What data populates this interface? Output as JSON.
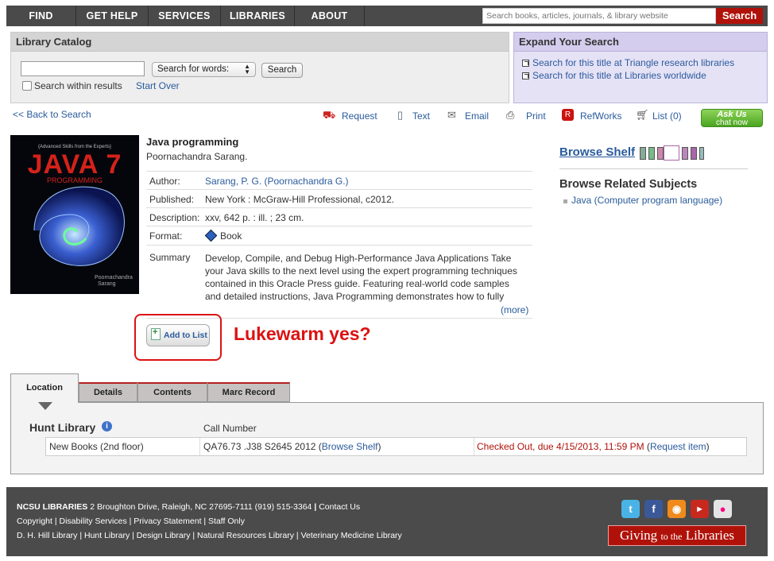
{
  "nav": {
    "items": [
      "FIND",
      "GET HELP",
      "SERVICES",
      "LIBRARIES",
      "ABOUT"
    ],
    "search_placeholder": "Search books, articles, journals, & library website",
    "search_button": "Search"
  },
  "catalog": {
    "heading": "Library Catalog",
    "select_value": "Search for words:",
    "search_button": "Search",
    "within_label": "Search within results",
    "start_over": "Start Over"
  },
  "expand": {
    "heading": "Expand Your Search",
    "links": [
      "Search for this title at Triangle research libraries",
      "Search for this title at Libraries worldwide"
    ]
  },
  "actions": {
    "back": "<< Back to Search",
    "request": "Request",
    "text": "Text",
    "email": "Email",
    "print": "Print",
    "refworks": "RefWorks",
    "list": "List (0)",
    "ask_us_1": "Ask Us",
    "ask_us_2": "chat now"
  },
  "record": {
    "cover_series": "{Advanced Skills from the Experts}",
    "cover_title": "JAVA 7",
    "cover_sub": "PROGRAMMING",
    "cover_author_1": "Poornachandra",
    "cover_author_2": "Sarang",
    "title": "Java programming",
    "responsibility": "Poornachandra Sarang.",
    "author_label": "Author:",
    "author": "Sarang, P. G. (Poornachandra G.)",
    "published_label": "Published:",
    "published": "New York : McGraw-Hill Professional, c2012.",
    "description_label": "Description:",
    "description": "xxv, 642 p. : ill. ; 23 cm.",
    "format_label": "Format:",
    "format": "Book",
    "summary_label": "Summary",
    "summary": "Develop, Compile, and Debug High-Performance Java Applications Take your Java skills to the next level using the expert programming techniques contained in this Oracle Press guide. Featuring real-world code samples and detailed instructions, Java Programming demonstrates how to fully",
    "more": "(more)",
    "add_to_list": "Add to List",
    "annotation": "Lukewarm yes?"
  },
  "sidebar": {
    "browse_shelf": "Browse Shelf",
    "related_heading": "Browse Related Subjects",
    "subject": "Java (Computer program language)",
    "book_colors": [
      "#8a9",
      "#7b8",
      "#c8a",
      "#b8b",
      "#a6a",
      "#9bb"
    ]
  },
  "tabs": [
    "Location",
    "Details",
    "Contents",
    "Marc Record"
  ],
  "location": {
    "library": "Hunt Library",
    "call_number_heading": "Call Number",
    "collection": "New Books (2nd floor)",
    "call_number": "QA76.73 .J38 S2645 2012",
    "browse_shelf_link": "Browse Shelf",
    "status": "Checked Out, due 4/15/2013, 11:59 PM",
    "request_item": "Request item"
  },
  "footer": {
    "org": "NCSU LIBRARIES",
    "address": "2 Broughton Drive, Raleigh, NC 27695-7111 (919) 515-3364",
    "contact": "Contact Us",
    "line2": [
      "Copyright",
      "Disability Services",
      "Privacy Statement",
      "Staff Only"
    ],
    "line3": [
      "D. H. Hill Library",
      "Hunt Library",
      "Design Library",
      "Natural Resources Library",
      "Veterinary Medicine Library"
    ],
    "giving_1": "Giving",
    "giving_2": "to the",
    "giving_3": "Libraries",
    "social": [
      "twitter-icon",
      "facebook-icon",
      "rss-icon",
      "youtube-icon",
      "flickr-icon"
    ]
  },
  "colors": {
    "nav": "#4a4a4a",
    "brand_red": "#b0120a",
    "link": "#2a5b9c",
    "status_red": "#b0120a",
    "annotation": "#dd1111"
  }
}
